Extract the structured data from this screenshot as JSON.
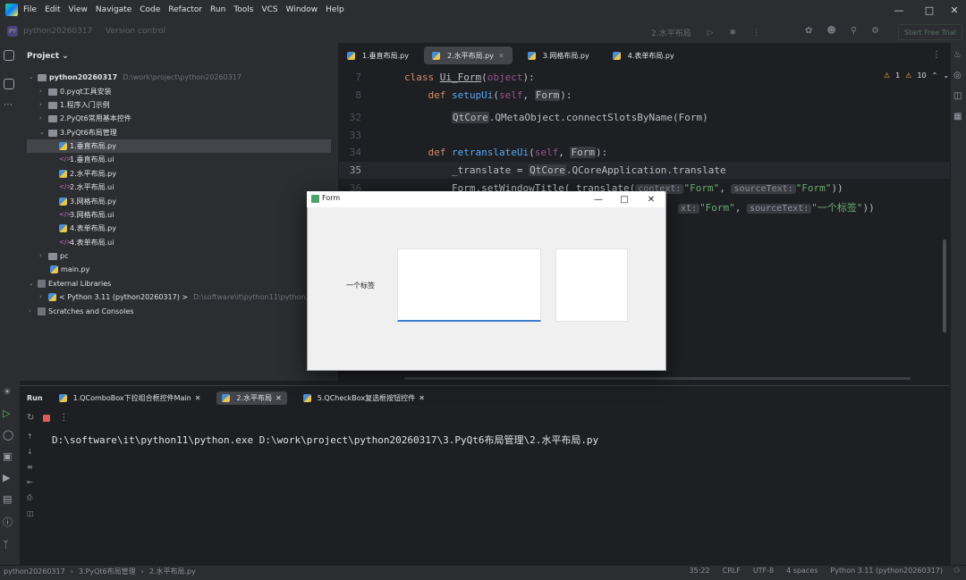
{
  "menu": [
    "File",
    "Edit",
    "View",
    "Navigate",
    "Code",
    "Refactor",
    "Run",
    "Tools",
    "VCS",
    "Window",
    "Help"
  ],
  "toolbar": {
    "project_badge": "PY",
    "project_name": "python20260317",
    "version_control": "Version control",
    "run_config": "2.水平布局",
    "start_trial": "Start Free Trial"
  },
  "project_panel": {
    "title": "Project",
    "root": "python20260317",
    "root_path": "D:\\work\\project\\python20260317",
    "folders": [
      "0.pyqt工具安装",
      "1.程序入门示例",
      "2.PyQt6常用基本控件",
      "3.PyQt6布局管理"
    ],
    "layout_files": [
      "1.垂直布局.py",
      "1.垂直布局.ui",
      "2.水平布局.py",
      "2.水平布局.ui",
      "3.网格布局.py",
      "3.网格布局.ui",
      "4.表单布局.py",
      "4.表单布局.ui"
    ],
    "pc_folder": "pc",
    "main_file": "main.py",
    "external": "External Libraries",
    "python_sdk": "< Python 3.11 (python20260317) >",
    "python_sdk_path": "D:\\software\\it\\python11\\python.exe",
    "scratches": "Scratches and Consoles"
  },
  "editor": {
    "tabs": [
      "1.垂直布局.py",
      "2.水平布局.py",
      "3.网格布局.py",
      "4.表单布局.py"
    ],
    "line_numbers": [
      "7",
      "8",
      "32",
      "33",
      "34",
      "35",
      "36"
    ],
    "warnings": "1",
    "weak_warnings": "10"
  },
  "form_window": {
    "title": "Form",
    "label": "一个标签"
  },
  "run_panel": {
    "title": "Run",
    "tabs": [
      "1.QComboBox下拉组合框控件Main",
      "2.水平布局",
      "5.QCheckBox复选框按钮控件"
    ],
    "output": "D:\\software\\it\\python11\\python.exe D:\\work\\project\\python20260317\\3.PyQt6布局管理\\2.水平布局.py"
  },
  "status_bar": {
    "crumbs": [
      "python20260317",
      "3.PyQt6布局管理",
      "2.水平布局.py"
    ],
    "position": "35:22",
    "line_sep": "CRLF",
    "encoding": "UTF-8",
    "indent": "4 spaces",
    "interpreter": "Python 3.11 (python20260317)"
  }
}
